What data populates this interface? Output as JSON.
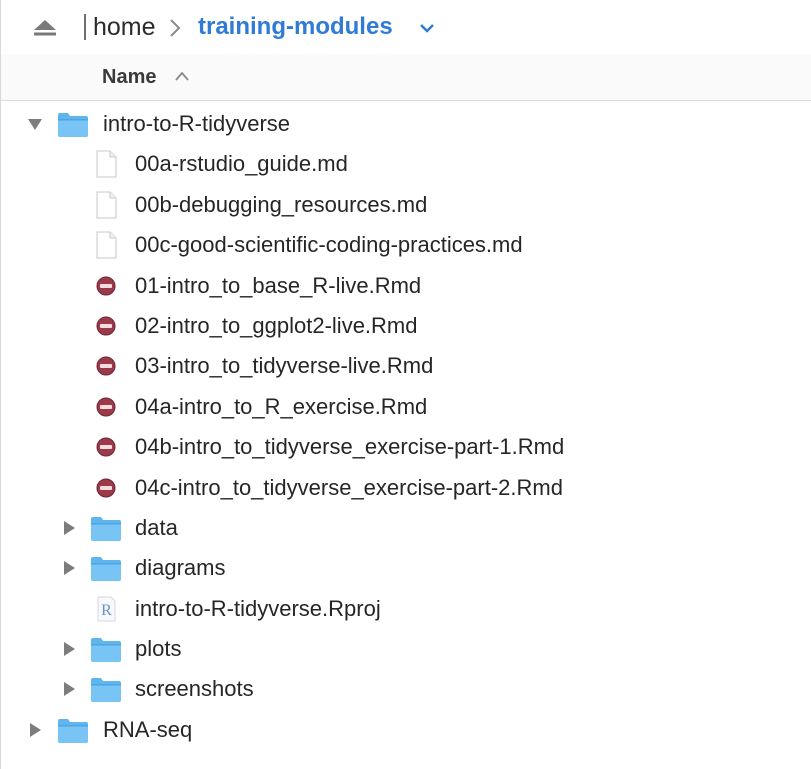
{
  "pathbar": {
    "home": "home",
    "current": "training-modules"
  },
  "columns": {
    "name": "Name"
  },
  "rows": [
    {
      "label": "intro-to-R-tidyverse",
      "type": "folder",
      "level": 0,
      "expanded": true
    },
    {
      "label": "00a-rstudio_guide.md",
      "type": "file",
      "level": 1
    },
    {
      "label": "00b-debugging_resources.md",
      "type": "file",
      "level": 1
    },
    {
      "label": "00c-good-scientific-coding-practices.md",
      "type": "file",
      "level": 1
    },
    {
      "label": "01-intro_to_base_R-live.Rmd",
      "type": "rmd",
      "level": 1
    },
    {
      "label": "02-intro_to_ggplot2-live.Rmd",
      "type": "rmd",
      "level": 1
    },
    {
      "label": "03-intro_to_tidyverse-live.Rmd",
      "type": "rmd",
      "level": 1
    },
    {
      "label": "04a-intro_to_R_exercise.Rmd",
      "type": "rmd",
      "level": 1
    },
    {
      "label": "04b-intro_to_tidyverse_exercise-part-1.Rmd",
      "type": "rmd",
      "level": 1
    },
    {
      "label": "04c-intro_to_tidyverse_exercise-part-2.Rmd",
      "type": "rmd",
      "level": 1
    },
    {
      "label": "data",
      "type": "folder",
      "level": 1,
      "expanded": false
    },
    {
      "label": "diagrams",
      "type": "folder",
      "level": 1,
      "expanded": false
    },
    {
      "label": "intro-to-R-tidyverse.Rproj",
      "type": "rproj",
      "level": 1
    },
    {
      "label": "plots",
      "type": "folder",
      "level": 1,
      "expanded": false
    },
    {
      "label": "screenshots",
      "type": "folder",
      "level": 1,
      "expanded": false
    },
    {
      "label": "RNA-seq",
      "type": "folder",
      "level": 0,
      "expanded": false
    }
  ],
  "icons": {
    "folder": "folder-icon",
    "file": "document-icon",
    "rmd": "rmd-file-icon",
    "rproj": "rproj-file-icon",
    "eject": "eject-icon",
    "chevron": "chevron-right-icon",
    "dropdown": "chevron-down-icon",
    "sort": "sort-ascending-icon"
  },
  "colors": {
    "accent": "#2f7bd6",
    "folder": "#5fb6ef",
    "rmd": "#9b3a4a"
  }
}
